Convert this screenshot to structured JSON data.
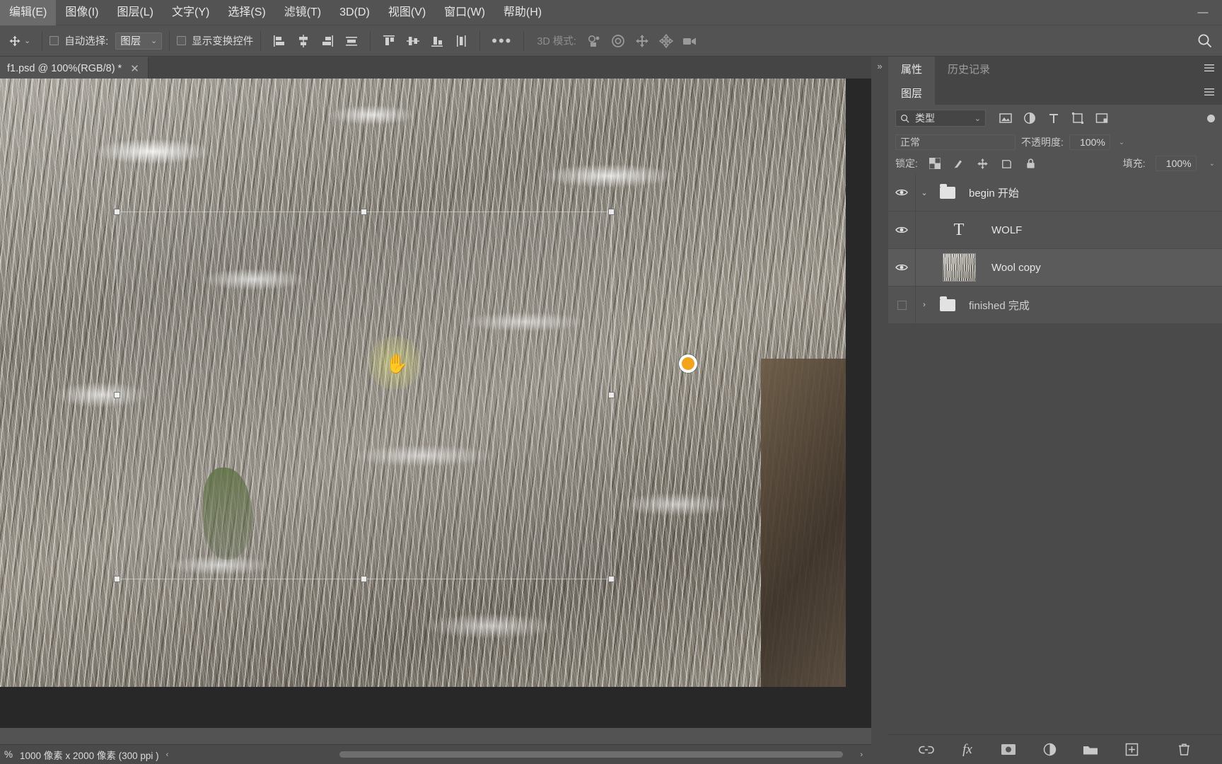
{
  "window": {
    "minimize_label": "—",
    "maximize_label": "▢",
    "close_label": "✕"
  },
  "menubar": {
    "items": [
      {
        "label": "编辑(E)"
      },
      {
        "label": "图像(I)"
      },
      {
        "label": "图层(L)"
      },
      {
        "label": "文字(Y)"
      },
      {
        "label": "选择(S)"
      },
      {
        "label": "滤镜(T)"
      },
      {
        "label": "3D(D)"
      },
      {
        "label": "视图(V)"
      },
      {
        "label": "窗口(W)"
      },
      {
        "label": "帮助(H)"
      }
    ]
  },
  "optionsbar": {
    "tool_icon": "move-tool-icon",
    "auto_select_label": "自动选择:",
    "auto_select_value": "图层",
    "show_transform_label": "显示变换控件",
    "align_icons": [
      "align-left-edges-icon",
      "align-horizontal-centers-icon",
      "align-right-edges-icon",
      "distribute-horizontal-icon"
    ],
    "align_icons2": [
      "align-top-edges-icon",
      "align-vertical-centers-icon",
      "align-bottom-edges-icon",
      "distribute-vertical-icon"
    ],
    "more_label": "•••",
    "mode3d_label": "3D 模式:",
    "mode3d_icons": [
      "orbit-3d-icon",
      "roll-3d-icon",
      "pan-3d-icon",
      "slide-3d-icon",
      "zoom-3d-camera-icon"
    ],
    "search_icon": "search-icon"
  },
  "document": {
    "tab_title": "f1.psd @ 100%(RGB/8) *",
    "close_icon": "close-icon"
  },
  "statusbar": {
    "zoom_label": "%",
    "dimensions": "1000 像素 x 2000 像素 (300 ppi )",
    "chevron": "‹",
    "right_chevron": "›"
  },
  "panels": {
    "top_tabs": [
      {
        "label": "属性",
        "active": true
      },
      {
        "label": "历史记录",
        "active": false
      }
    ],
    "layers_tab": {
      "label": "图层",
      "active": true
    },
    "menu_icon": "panel-menu-icon",
    "filter": {
      "search_icon": "search-icon",
      "type_label": "类型",
      "chevron": "⌄",
      "icons": [
        "filter-pixel-icon",
        "filter-adjustment-icon",
        "filter-type-icon",
        "filter-shape-icon",
        "filter-smart-object-icon"
      ],
      "toggle": "filter-power-toggle"
    },
    "blend": {
      "mode_value": "正常",
      "opacity_label": "不透明度:",
      "opacity_value": "100%",
      "fill_label": "填充:",
      "fill_value": "100%"
    },
    "lock": {
      "label": "锁定:",
      "icons": [
        "lock-transparent-pixels-icon",
        "lock-image-pixels-icon",
        "lock-position-icon",
        "lock-artboard-nesting-icon",
        "lock-all-icon"
      ]
    },
    "layers": [
      {
        "name": "begin 开始",
        "type": "group",
        "visible": true,
        "expanded": true,
        "disclosure": "⌄",
        "indent": 0,
        "selected": false
      },
      {
        "name": "WOLF",
        "type": "text",
        "visible": true,
        "thumb_glyph": "T",
        "indent": 1,
        "selected": false
      },
      {
        "name": "Wool copy",
        "type": "image",
        "visible": true,
        "indent": 1,
        "selected": true
      },
      {
        "name": "finished 完成",
        "type": "group",
        "visible": false,
        "expanded": false,
        "disclosure": "›",
        "indent": 0,
        "selected": false
      }
    ],
    "bottom_icons": [
      "link-layers-icon",
      "layer-style-fx-icon",
      "add-layer-mask-icon",
      "new-adjustment-layer-icon",
      "new-group-icon",
      "new-layer-icon",
      "delete-layer-icon"
    ],
    "bottom_labels": {
      "fx": "fx"
    }
  },
  "colors": {
    "chrome": "#535353",
    "panel": "#4a4a4a",
    "selection": "#5b5b5b",
    "accent_marker": "#f2a41c",
    "text": "#e6e6e6",
    "muted_text": "#9d9d9d"
  }
}
